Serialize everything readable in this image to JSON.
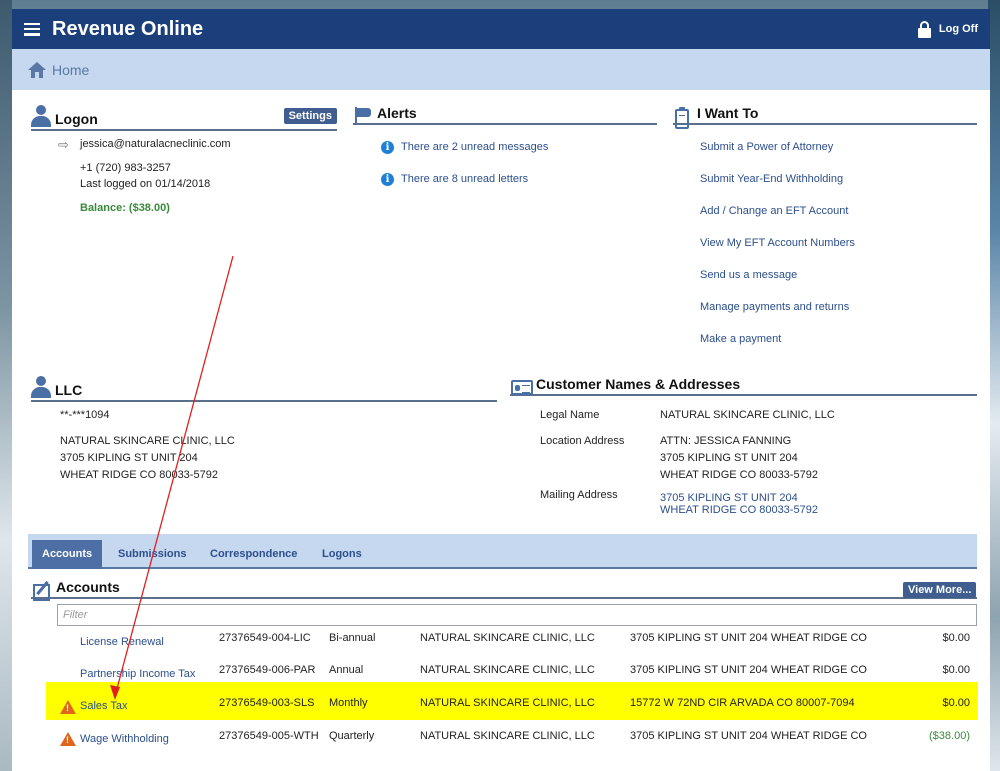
{
  "header": {
    "title": "Revenue Online",
    "logoff_label": "Log Off"
  },
  "breadcrumb": {
    "home_label": "Home"
  },
  "logon": {
    "title": "Logon",
    "settings_label": "Settings",
    "email": "jessica@naturalacneclinic.com",
    "phone": "+1 (720) 983-3257",
    "last_logged": "Last logged on 01/14/2018",
    "balance": "Balance: ($38.00)"
  },
  "alerts": {
    "title": "Alerts",
    "items": [
      "There are 2 unread messages",
      "There are 8 unread letters"
    ]
  },
  "iwantto": {
    "title": "I Want To",
    "items": [
      "Submit a Power of Attorney",
      "Submit Year-End Withholding",
      "Add / Change an EFT Account",
      "View My EFT Account Numbers",
      "Send us a message",
      "Manage payments and returns",
      "Make a payment"
    ]
  },
  "llc": {
    "title": "LLC",
    "id": "**-***1094",
    "name": "NATURAL SKINCARE CLINIC, LLC",
    "address1": "3705 KIPLING ST UNIT 204",
    "address2": "WHEAT RIDGE CO  80033-5792"
  },
  "customer": {
    "title": "Customer Names & Addresses",
    "legal_label": "Legal Name",
    "legal_value": "NATURAL SKINCARE CLINIC, LLC",
    "location_label": "Location Address",
    "location_line1": "ATTN: JESSICA FANNING",
    "location_line2": "3705 KIPLING ST UNIT 204",
    "location_line3": "WHEAT RIDGE CO  80033-5792",
    "mailing_label": "Mailing Address",
    "mailing_line1": "3705 KIPLING ST UNIT 204",
    "mailing_line2": "WHEAT RIDGE CO  80033-5792"
  },
  "tabs": [
    "Accounts",
    "Submissions",
    "Correspondence",
    "Logons"
  ],
  "accounts": {
    "title": "Accounts",
    "view_more_label": "View More...",
    "filter_placeholder": "Filter",
    "rows": [
      {
        "name": "License Renewal",
        "number": "27376549-004-LIC",
        "freq": "Bi-annual",
        "entity": "NATURAL SKINCARE CLINIC, LLC",
        "address": "3705 KIPLING ST UNIT 204 WHEAT RIDGE CO",
        "balance": "$0.00",
        "warning": false
      },
      {
        "name": "Partnership Income Tax",
        "number": "27376549-006-PAR",
        "freq": "Annual",
        "entity": "NATURAL SKINCARE CLINIC, LLC",
        "address": "3705 KIPLING ST UNIT 204 WHEAT RIDGE CO",
        "balance": "$0.00",
        "warning": false
      },
      {
        "name": "Sales Tax",
        "number": "27376549-003-SLS",
        "freq": "Monthly",
        "entity": "NATURAL SKINCARE CLINIC, LLC",
        "address": "15772 W 72ND CIR ARVADA CO 80007-7094",
        "balance": "$0.00",
        "warning": true
      },
      {
        "name": "Wage Withholding",
        "number": "27376549-005-WTH",
        "freq": "Quarterly",
        "entity": "NATURAL SKINCARE CLINIC, LLC",
        "address": "3705 KIPLING ST UNIT 204 WHEAT RIDGE CO",
        "balance": "($38.00)",
        "warning": true
      }
    ]
  },
  "colors": {
    "header": "#1b3f7a",
    "subbar": "#c6d7f0",
    "highlight": "#ffff00",
    "annotation": "#e02020",
    "warning": "#e0661b"
  }
}
